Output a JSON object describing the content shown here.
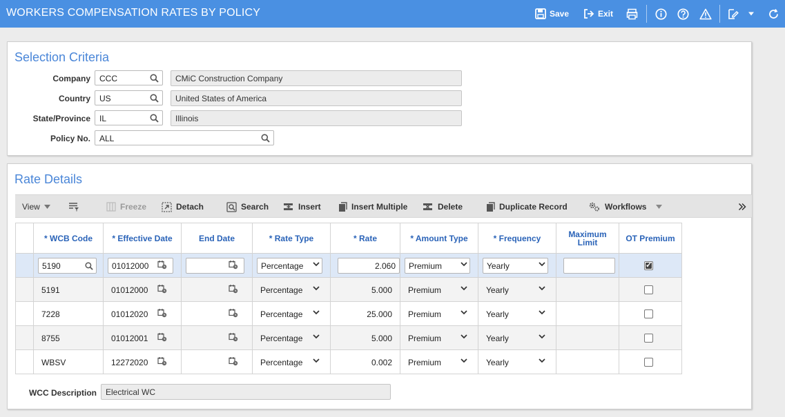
{
  "app": {
    "title": "WORKERS COMPENSATION RATES BY POLICY",
    "save_label": "Save",
    "exit_label": "Exit"
  },
  "selection": {
    "title": "Selection Criteria",
    "company_label": "Company",
    "company_code": "CCC",
    "company_name": "CMiC Construction Company",
    "country_label": "Country",
    "country_code": "US",
    "country_name": "United States of America",
    "state_label": "State/Province",
    "state_code": "IL",
    "state_name": "Illinois",
    "policy_label": "Policy No.",
    "policy_value": "ALL"
  },
  "rate_details": {
    "title": "Rate Details",
    "toolbar": {
      "view": "View",
      "freeze": "Freeze",
      "detach": "Detach",
      "search": "Search",
      "insert": "Insert",
      "insert_multiple": "Insert Multiple",
      "delete": "Delete",
      "duplicate": "Duplicate Record",
      "workflows": "Workflows"
    },
    "columns": {
      "wcb_code": "* WCB Code",
      "effective_date": "* Effective Date",
      "end_date": "End Date",
      "rate_type": "* Rate Type",
      "rate": "* Rate",
      "amount_type": "* Amount Type",
      "frequency": "* Frequency",
      "max_limit_1": "Maximum",
      "max_limit_2": "Limit",
      "ot_premium": "OT Premium"
    },
    "rows": [
      {
        "wcb": "5190",
        "eff": "01012000",
        "end": "",
        "rate_type": "Percentage",
        "rate": "2.060",
        "amount_type": "Premium",
        "frequency": "Yearly",
        "max": "",
        "ot": true
      },
      {
        "wcb": "5191",
        "eff": "01012000",
        "end": "",
        "rate_type": "Percentage",
        "rate": "5.000",
        "amount_type": "Premium",
        "frequency": "Yearly",
        "max": "",
        "ot": false
      },
      {
        "wcb": "7228",
        "eff": "01012020",
        "end": "",
        "rate_type": "Percentage",
        "rate": "25.000",
        "amount_type": "Premium",
        "frequency": "Yearly",
        "max": "",
        "ot": false
      },
      {
        "wcb": "8755",
        "eff": "01012001",
        "end": "",
        "rate_type": "Percentage",
        "rate": "5.000",
        "amount_type": "Premium",
        "frequency": "Yearly",
        "max": "",
        "ot": false
      },
      {
        "wcb": "WBSV",
        "eff": "12272020",
        "end": "",
        "rate_type": "Percentage",
        "rate": "0.002",
        "amount_type": "Premium",
        "frequency": "Yearly",
        "max": "",
        "ot": false
      }
    ],
    "wcc_label": "WCC Description",
    "wcc_value": "Electrical WC"
  },
  "colors": {
    "header": "#4a90e2",
    "accent_text": "#4a86d8",
    "column_header": "#2a63b8",
    "selected_row": "#dde8f7"
  }
}
